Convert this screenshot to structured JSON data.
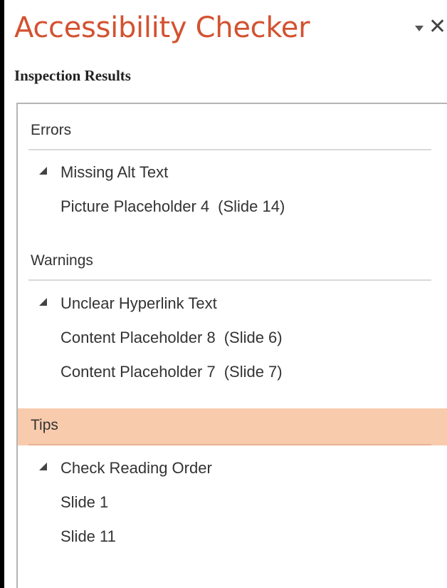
{
  "header": {
    "title": "Accessibility Checker",
    "subtitle": "Inspection Results"
  },
  "sections": {
    "errors": {
      "label": "Errors",
      "groups": [
        {
          "label": "Missing Alt Text",
          "items": [
            {
              "name": "Picture Placeholder 4",
              "slide": "(Slide 14)"
            }
          ]
        }
      ]
    },
    "warnings": {
      "label": "Warnings",
      "groups": [
        {
          "label": "Unclear Hyperlink Text",
          "items": [
            {
              "name": "Content Placeholder 8",
              "slide": "(Slide 6)"
            },
            {
              "name": "Content Placeholder 7",
              "slide": "(Slide 7)"
            }
          ]
        }
      ]
    },
    "tips": {
      "label": "Tips",
      "selected": true,
      "groups": [
        {
          "label": "Check Reading Order",
          "items": [
            {
              "name": "Slide 1"
            },
            {
              "name": "Slide 11"
            }
          ]
        }
      ]
    }
  },
  "colors": {
    "title": "#d35230",
    "selected_header": "#f8cbad"
  },
  "icons": {
    "dropdown": "chevron-down-icon",
    "close": "close-icon",
    "expander": "collapse-triangle-icon"
  }
}
